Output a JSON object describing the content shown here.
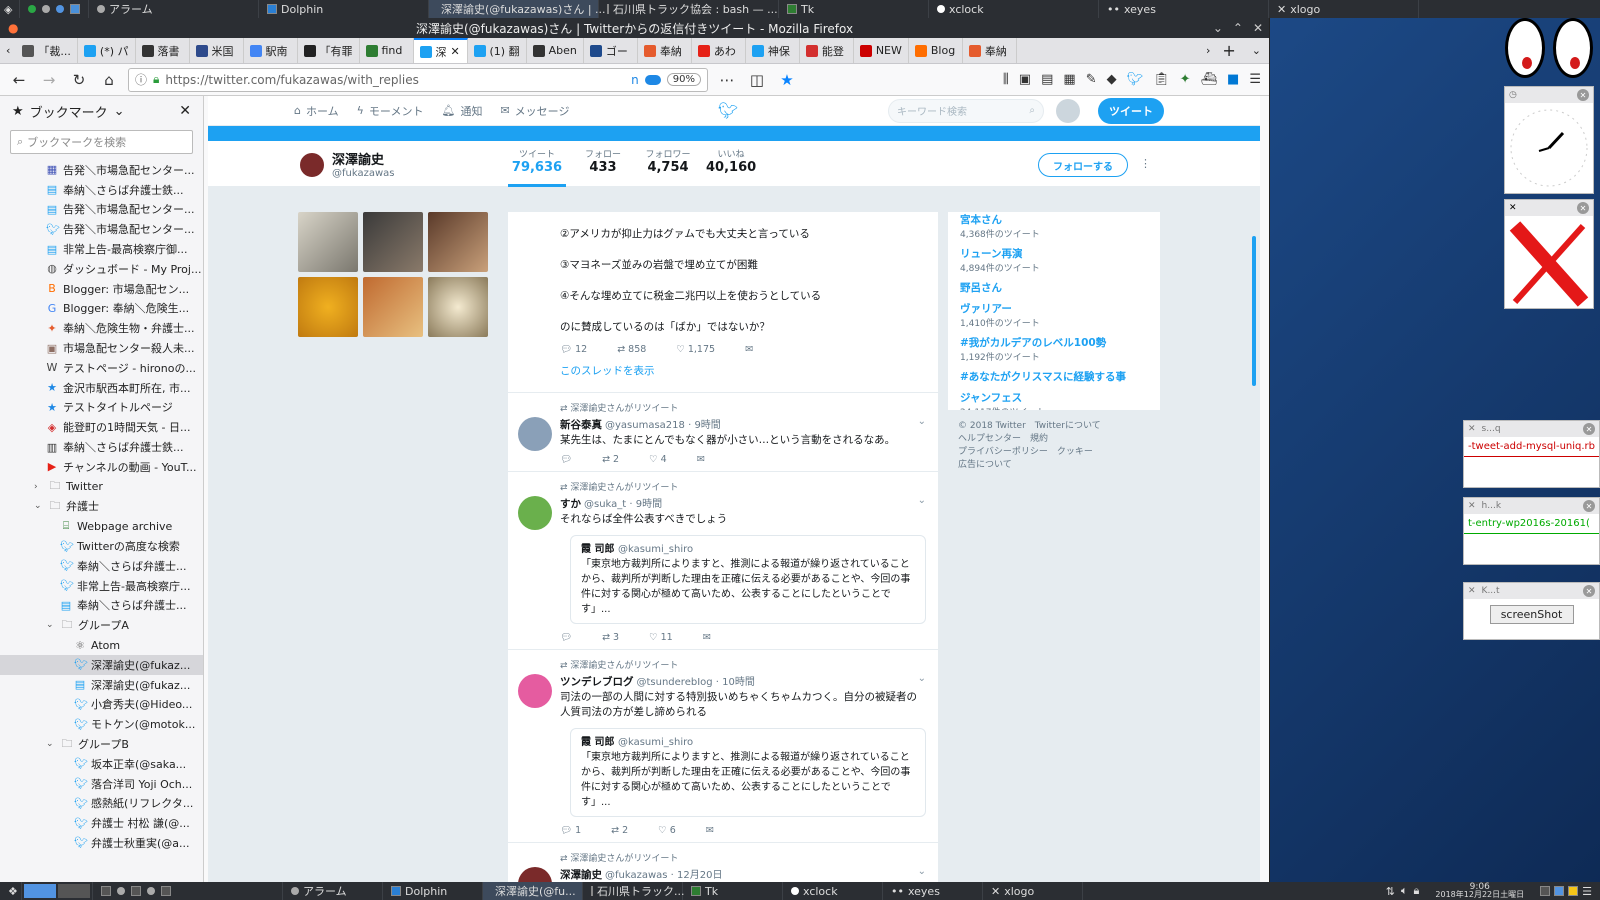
{
  "topbar": {
    "items": [
      "アラーム",
      "Dolphin",
      "深澤諭史(@fukazawas)さん | ...",
      "石川県トラック協会 : bash — ...",
      "Tk",
      "xclock",
      "xeyes",
      "xlogo"
    ]
  },
  "firefox": {
    "title": "深澤諭史(@fukazawas)さん | Twitterからの返信付きツイート - Mozilla Firefox",
    "tabs": [
      "「裁...",
      "(*) パ",
      "落書",
      "米国",
      "駅南",
      "「有罪",
      "find",
      "深",
      "(1) 翻",
      "Aben",
      "ゴー",
      "奉納",
      "あわ",
      "神保",
      "能登",
      "NEW",
      "Blog",
      "奉納"
    ],
    "url": "https://twitter.com/fukazawas/with_replies",
    "zoom": "90%",
    "url_extra": "n"
  },
  "sidebar": {
    "title": "ブックマーク",
    "search_placeholder": "ブックマークを検索",
    "items": [
      {
        "label": "告発＼市場急配センター...",
        "icon": "calendar",
        "color": "#3f51b5"
      },
      {
        "label": "奉納＼さらば弁護士鉄...",
        "icon": "tweetdeck",
        "color": "#1da1f2"
      },
      {
        "label": "告発＼市場急配センター...",
        "icon": "tweetdeck",
        "color": "#1da1f2"
      },
      {
        "label": "告発＼市場急配センター...",
        "icon": "twitter",
        "color": "#1da1f2"
      },
      {
        "label": "非常上告-最高検察庁御...",
        "icon": "tweetdeck",
        "color": "#1da1f2"
      },
      {
        "label": "ダッシュボード - My Proj...",
        "icon": "globe",
        "color": "#555"
      },
      {
        "label": "Blogger: 市場急配セン...",
        "icon": "blogger",
        "color": "#ff6d00"
      },
      {
        "label": "Blogger: 奉納＼危険生...",
        "icon": "google",
        "color": "#4285f4"
      },
      {
        "label": "奉納＼危険生物・弁護士...",
        "icon": "fox",
        "color": "#e55b2d"
      },
      {
        "label": "市場急配センター殺人未...",
        "icon": "photo",
        "color": "#8d6e63"
      },
      {
        "label": "テストページ - hironoの...",
        "icon": "wiki",
        "color": "#444"
      },
      {
        "label": "金沢市駅西本町所在, 市...",
        "icon": "star",
        "color": "#1e88e5"
      },
      {
        "label": "テストタイトルページ",
        "icon": "star",
        "color": "#1e88e5"
      },
      {
        "label": "能登町の1時間天気 - 日...",
        "icon": "cube",
        "color": "#d32f2f"
      },
      {
        "label": "奉納＼さらば弁護士鉄...",
        "icon": "chart",
        "color": "#333"
      },
      {
        "label": "チャンネルの動画 - YouT...",
        "icon": "youtube",
        "color": "#e62117"
      }
    ],
    "folders": [
      {
        "label": "Twitter",
        "open": false
      },
      {
        "label": "弁護士",
        "open": true
      }
    ],
    "lawyer_items": [
      {
        "label": "Webpage archive",
        "icon": "archive",
        "color": "#2e7d32"
      },
      {
        "label": "Twitterの高度な検索",
        "icon": "twitter",
        "color": "#1da1f2"
      },
      {
        "label": "奉納＼さらば弁護士...",
        "icon": "twitter",
        "color": "#1da1f2"
      },
      {
        "label": "非常上告-最高検察庁...",
        "icon": "twitter",
        "color": "#1da1f2"
      },
      {
        "label": "奉納＼さらば弁護士...",
        "icon": "tweetdeck",
        "color": "#1da1f2"
      }
    ],
    "group_a": {
      "label": "グループA",
      "items": [
        {
          "label": "Atom",
          "icon": "atom",
          "color": "#555"
        },
        {
          "label": "深澤諭史(@fukaz...",
          "icon": "twitter",
          "color": "#1da1f2",
          "selected": true
        },
        {
          "label": "深澤諭史(@fukaz...",
          "icon": "tweetdeck",
          "color": "#1da1f2"
        },
        {
          "label": "小倉秀夫(@Hideo...",
          "icon": "twitter",
          "color": "#1da1f2"
        },
        {
          "label": "モトケン(@motok...",
          "icon": "twitter",
          "color": "#1da1f2"
        }
      ]
    },
    "group_b": {
      "label": "グループB",
      "items": [
        {
          "label": "坂本正幸(@saka...",
          "icon": "twitter",
          "color": "#1da1f2"
        },
        {
          "label": "落合洋司 Yoji Och...",
          "icon": "twitter",
          "color": "#1da1f2"
        },
        {
          "label": "感熱紙(リフレクタ...",
          "icon": "twitter",
          "color": "#1da1f2"
        },
        {
          "label": "弁護士 村松 謙(@...",
          "icon": "twitter",
          "color": "#1da1f2"
        },
        {
          "label": "弁護士秋重実(@a...",
          "icon": "twitter",
          "color": "#1da1f2"
        }
      ]
    }
  },
  "twitter": {
    "nav": {
      "home": "ホーム",
      "moments": "モーメント",
      "notifications": "通知",
      "messages": "メッセージ",
      "search_placeholder": "キーワード検索",
      "tweet_button": "ツイート"
    },
    "profile": {
      "name": "深澤諭史",
      "handle": "@fukazawas",
      "follow": "フォローする",
      "stats": [
        {
          "label": "ツイート",
          "value": "79,636"
        },
        {
          "label": "フォロー",
          "value": "433"
        },
        {
          "label": "フォロワー",
          "value": "4,754"
        },
        {
          "label": "いいね",
          "value": "40,160"
        }
      ]
    },
    "first_tweet": {
      "lines": [
        "②アメリカが抑止力はグァムでも大丈夫と言っている",
        "③マヨネーズ並みの岩盤で埋め立てが困難",
        "④そんな埋め立てに税金二兆円以上を使おうとしている",
        "のに賛成しているのは「ばか」ではないか？"
      ],
      "replies": "12",
      "retweets": "858",
      "likes": "1,175",
      "show_thread": "このスレッドを表示"
    },
    "tweets": [
      {
        "rt": "深澤諭史さんがリツイート",
        "name": "新谷泰真",
        "handle": "@yasumasa218",
        "time": "9時間",
        "text": "某先生は、たまにとんでもなく器が小さい…という言動をされるなあ。",
        "replies": "",
        "retweets": "2",
        "likes": "4"
      },
      {
        "rt": "深澤諭史さんがリツイート",
        "name": "すか",
        "handle": "@suka_t",
        "time": "9時間",
        "text": "それならば全件公表すべきでしょう",
        "quote": {
          "name": "霞 司郎",
          "handle": "@kasumi_shiro",
          "text": "「東京地方裁判所によりますと、推測による報道が繰り返されていることから、裁判所が判断した理由を正確に伝える必要があることや、今回の事件に対する関心が極めて高いため、公表することにしたということです」..."
        },
        "replies": "",
        "retweets": "3",
        "likes": "11"
      },
      {
        "rt": "深澤諭史さんがリツイート",
        "name": "ツンデレブログ",
        "handle": "@tsunderebIog",
        "time": "10時間",
        "text": "司法の一部の人間に対する特別扱いめちゃくちゃムカつく。自分の被疑者の人質司法の方が差し諦められる",
        "quote": {
          "name": "霞 司郎",
          "handle": "@kasumi_shiro",
          "text": "「東京地方裁判所によりますと、推測による報道が繰り返されていることから、裁判所が判断した理由を正確に伝える必要があることや、今回の事件に対する関心が極めて高いため、公表することにしたということです」..."
        },
        "replies": "1",
        "retweets": "2",
        "likes": "6"
      },
      {
        "rt": "深澤諭史さんがリツイート",
        "name": "深澤諭史",
        "handle": "@fukazawas",
        "time": "12月20日",
        "text": ""
      }
    ],
    "trends": [
      {
        "title": "宮本さん",
        "count": "4,368件のツイート"
      },
      {
        "title": "リューン再演",
        "count": "4,894件のツイート"
      },
      {
        "title": "野呂さん",
        "count": ""
      },
      {
        "title": "ヴァリアー",
        "count": "1,410件のツイート"
      },
      {
        "title": "#我がカルデアのレベル100勢",
        "count": "1,192件のツイート"
      },
      {
        "title": "#あなたがクリスマスに経験する事",
        "count": ""
      },
      {
        "title": "ジャンフェス",
        "count": "24,117件のツイート"
      }
    ],
    "footer": {
      "line1": "© 2018 Twitter　Twitterについて",
      "line2": "ヘルプセンター　規約",
      "line3": "プライバシーポリシー　クッキー",
      "line4": "広告について"
    }
  },
  "widgets": {
    "term1": "-tweet-add-mysql-uniq.rb",
    "term2": "t-entry-wp2016s-20161(",
    "tk_button": "screenShot",
    "w1_title": "s...q",
    "w2_title": "h...k",
    "w3_title": "K...t"
  },
  "bottombar": {
    "items": [
      "アラーム",
      "Dolphin",
      "深澤諭史(@fu...",
      "石川県トラック...",
      "Tk",
      "xclock",
      "xeyes",
      "xlogo"
    ],
    "time": "9:06",
    "date": "2018年12月22日土曜日"
  }
}
